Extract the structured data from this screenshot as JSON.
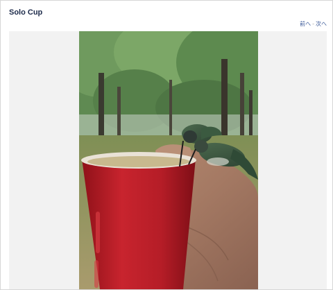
{
  "header": {
    "title": "Solo Cup"
  },
  "nav": {
    "prev_label": "前へ",
    "separator": "-",
    "next_label": "次へ"
  },
  "media": {
    "type": "video-frame",
    "subject_icon": "hummingbird-photo"
  },
  "colors": {
    "title": "#1c2a4a",
    "link": "#3b5998",
    "cup_red": "#c2222c",
    "stage_bg": "#f2f2f2"
  }
}
